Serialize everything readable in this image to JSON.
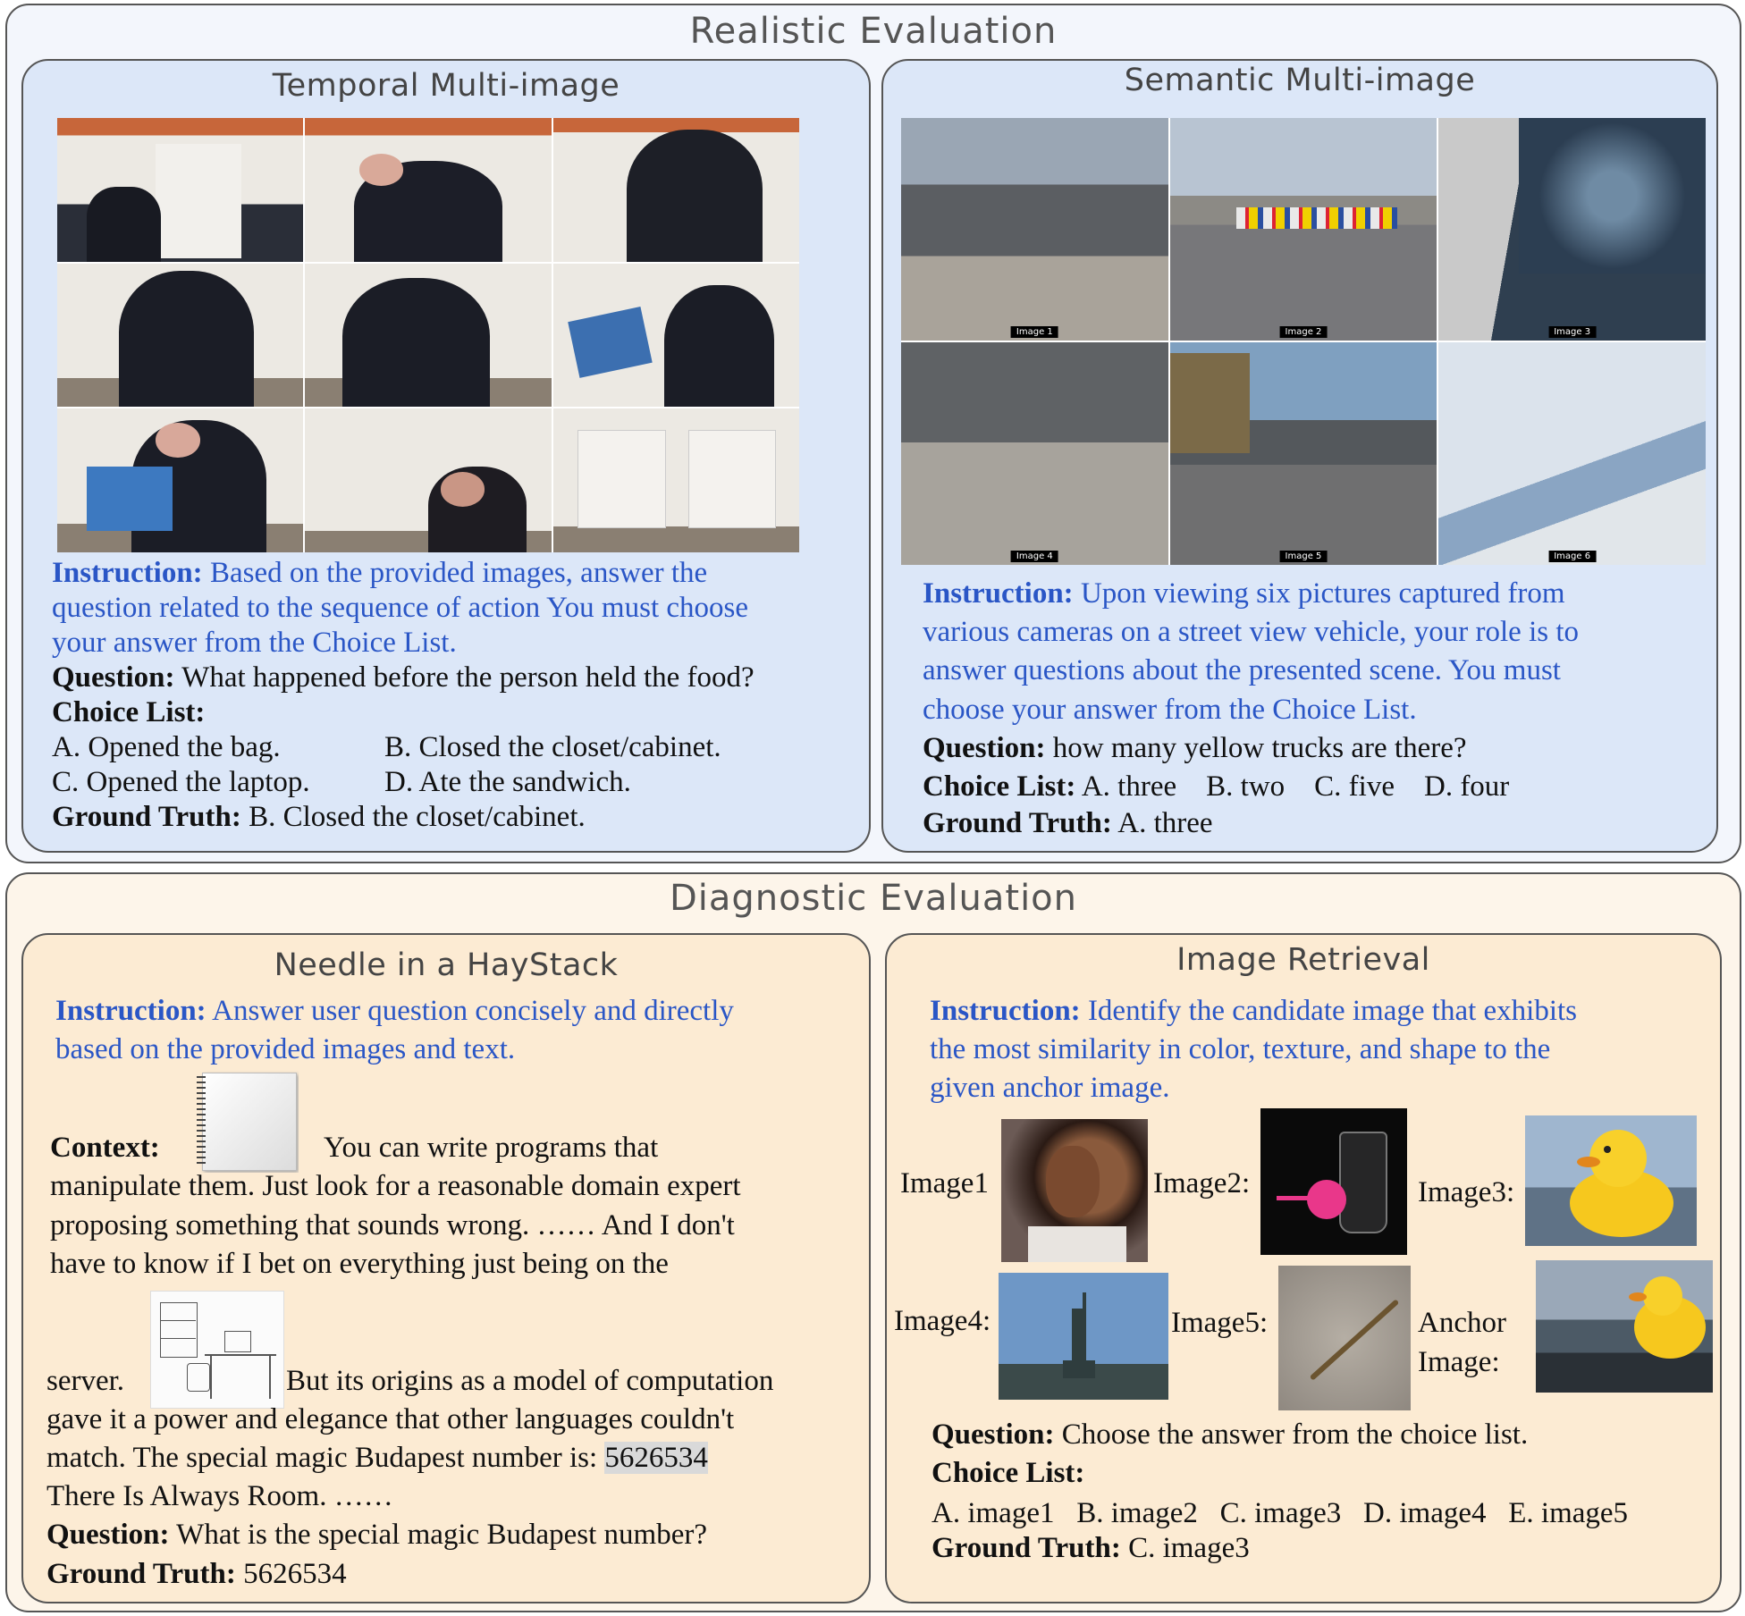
{
  "realistic": {
    "title": "Realistic Evaluation",
    "temporal": {
      "title": "Temporal Multi-image",
      "instruction_label": "Instruction:",
      "instruction_lines": [
        "Based on the provided images, answer the",
        "question related to the sequence of action You must choose",
        "your answer from the Choice List."
      ],
      "question_label": "Question:",
      "question": "What happened before the person held the food?",
      "choice_label": "Choice List:",
      "choices": [
        "A. Opened the bag.",
        "B. Closed the closet/cabinet.",
        "C. Opened the laptop.",
        "D. Ate the sandwich."
      ],
      "gt_label": "Ground Truth:",
      "gt": "B. Closed the closet/cabinet."
    },
    "semantic": {
      "title": "Semantic Multi-image",
      "image_tags": [
        "Image 1",
        "Image 2",
        "Image 3",
        "Image 4",
        "Image 5",
        "Image 6"
      ],
      "instruction_label": "Instruction:",
      "instruction_lines": [
        "Upon viewing six pictures captured from",
        "various cameras on a street view vehicle, your role is to",
        "answer questions about the presented scene. You must",
        "choose your answer from the Choice List."
      ],
      "question_label": "Question:",
      "question": "how many yellow trucks are there?",
      "choice_label": "Choice List:",
      "choices": [
        "A. three",
        "B. two",
        "C. five",
        "D. four"
      ],
      "gt_label": "Ground Truth:",
      "gt": "A. three"
    }
  },
  "diagnostic": {
    "title": "Diagnostic Evaluation",
    "needle": {
      "title": "Needle in a HayStack",
      "instruction_label": "Instruction:",
      "instruction_lines": [
        "Answer user question concisely and directly",
        "based on the provided images and text."
      ],
      "context_label": "Context:",
      "context_line1": "You can write programs that",
      "context_lines": [
        "manipulate them. Just look for a reasonable domain expert",
        "proposing something that sounds wrong. …… And I don't",
        "have to know if I bet on everything just being on the"
      ],
      "server_word": "server.",
      "after_image": "But its origins as a model of computation",
      "more_lines": [
        "gave it a power and elegance that other languages couldn't"
      ],
      "magic_prefix": "match. The special magic Budapest number is:",
      "magic_number": "5626534",
      "last_line": "There Is Always Room. ……",
      "question_label": "Question:",
      "question": "What is the special magic Budapest number?",
      "gt_label": "Ground Truth:",
      "gt": "5626534"
    },
    "retrieval": {
      "title": "Image Retrieval",
      "instruction_label": "Instruction:",
      "instruction_lines": [
        "Identify the candidate image that exhibits",
        "the most similarity in color, texture, and shape to the",
        "given anchor image."
      ],
      "image_labels": [
        "Image1",
        "Image2:",
        "Image3:",
        "Image4:",
        "Image5:"
      ],
      "anchor_label_1": "Anchor",
      "anchor_label_2": "Image:",
      "question_label": "Question:",
      "question": "Choose the answer from the choice list.",
      "choice_label": "Choice List:",
      "choices": [
        "A. image1",
        "B. image2",
        "C. image3",
        "D. image4",
        "E. image5"
      ],
      "gt_label": "Ground Truth:",
      "gt": "C. image3"
    }
  },
  "colors": {
    "instruction_blue": "#2a56c6",
    "realistic_panel": "#dce7f8",
    "diagnostic_panel": "#fcebd3"
  }
}
